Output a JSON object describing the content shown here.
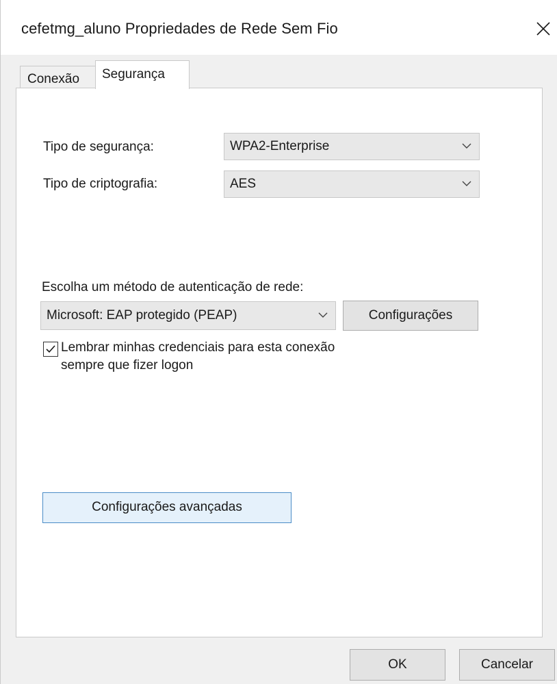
{
  "window": {
    "title": "cefetmg_aluno Propriedades de Rede Sem Fio"
  },
  "tabs": [
    {
      "label": "Conexão",
      "active": false
    },
    {
      "label": "Segurança",
      "active": true
    }
  ],
  "security": {
    "security_type_label": "Tipo de segurança:",
    "security_type_value": "WPA2-Enterprise",
    "encryption_type_label": "Tipo de criptografia:",
    "encryption_type_value": "AES",
    "auth_method_label": "Escolha um método de autenticação de rede:",
    "auth_method_value": "Microsoft: EAP protegido (PEAP)",
    "settings_button": "Configurações",
    "remember_checkbox_line1": "Lembrar minhas credenciais para esta conexão",
    "remember_checkbox_line2": "sempre que fizer logon",
    "remember_checked": true,
    "advanced_button": "Configurações avançadas"
  },
  "footer": {
    "ok_button": "OK",
    "cancel_button": "Cancelar"
  },
  "icons": {
    "close": "close-icon",
    "dropdown": "chevron-down-icon",
    "check": "checkmark-icon"
  },
  "colors": {
    "accent_border": "#4a8cc7",
    "accent_fill": "#e5f1fb"
  }
}
